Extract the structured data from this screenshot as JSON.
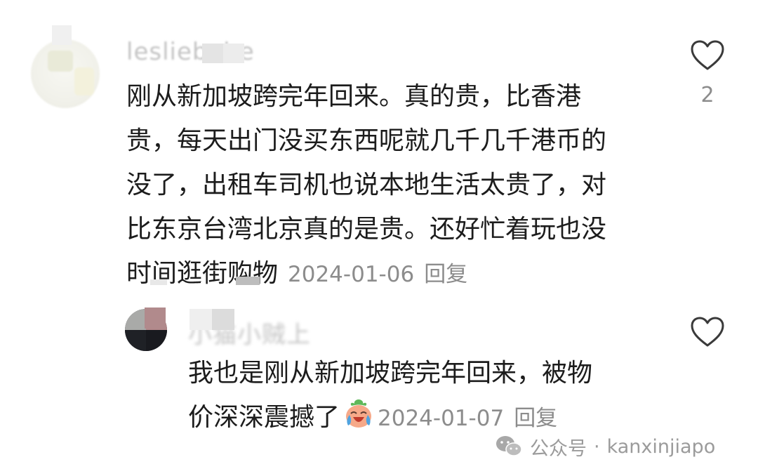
{
  "comments": [
    {
      "username": "lesliebabe",
      "text_lines": [
        "刚从新加坡跨完年回来。真的贵，比香港",
        "贵，每天出门没买东西呢就几千几千港币的",
        "没了，出租车司机也说本地生活太贵了，对",
        "比东京台湾北京真的是贵。还好忙着玩也没",
        "时间逛街购物"
      ],
      "date": "2024-01-06",
      "reply_label": "回复",
      "like_count": "2",
      "like_icon": "heart-outline-icon"
    },
    {
      "username": "小猫小贼上",
      "text_lines": [
        "我也是刚从新加坡跨完年回来，被物",
        "价深深震撼了"
      ],
      "emoji": "crying-laughing-emoji",
      "date": "2024-01-07",
      "reply_label": "回复",
      "like_icon": "heart-outline-icon"
    }
  ],
  "watermark": {
    "icon": "wechat-icon",
    "label": "公众号",
    "separator": "·",
    "account": "kanxinjiapo"
  },
  "colors": {
    "text": "#1c1c1c",
    "meta": "#8c8c8c",
    "username": "#c4c4c4"
  }
}
